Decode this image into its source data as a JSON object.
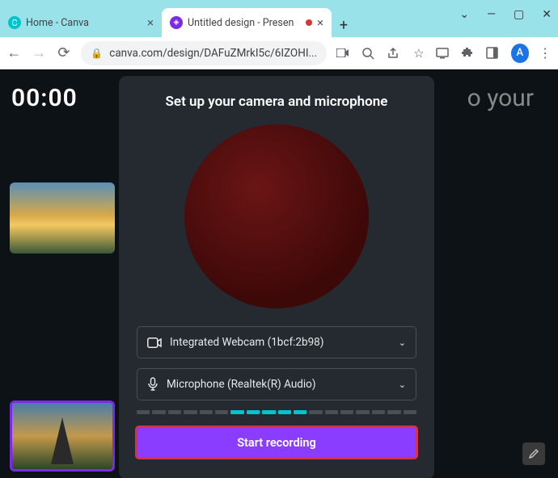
{
  "window": {
    "tab1_title": "Home - Canva",
    "tab2_title": "Untitled design - Presen",
    "url": "canva.com/design/DAFuZMrkI5c/6IZOHI...",
    "avatar_letter": "A"
  },
  "page": {
    "timer": "00:00",
    "bg_text": "o your"
  },
  "modal": {
    "title": "Set up your camera and microphone",
    "camera_label": "Integrated Webcam (1bcf:2b98)",
    "mic_label": "Microphone (Realtek(R) Audio)",
    "start_label": "Start recording",
    "meter_active": [
      false,
      false,
      false,
      false,
      false,
      false,
      true,
      true,
      true,
      true,
      true,
      false,
      false,
      false,
      false,
      false,
      false,
      false
    ]
  }
}
